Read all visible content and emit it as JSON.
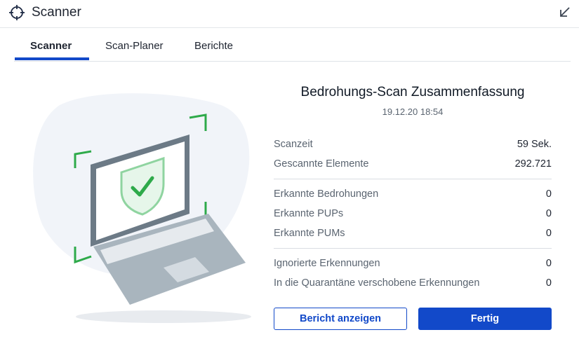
{
  "window": {
    "title": "Scanner"
  },
  "tabs": [
    {
      "label": "Scanner"
    },
    {
      "label": "Scan-Planer"
    },
    {
      "label": "Berichte"
    }
  ],
  "summary": {
    "title": "Bedrohungs-Scan Zusammenfassung",
    "date": "19.12.20 18:54",
    "rows": [
      {
        "label": "Scanzeit",
        "value": "59 Sek."
      },
      {
        "label": "Gescannte Elemente",
        "value": "292.721"
      },
      {
        "label": "Erkannte Bedrohungen",
        "value": "0"
      },
      {
        "label": "Erkannte PUPs",
        "value": "0"
      },
      {
        "label": "Erkannte PUMs",
        "value": "0"
      },
      {
        "label": "Ignorierte Erkennungen",
        "value": "0"
      },
      {
        "label": "In die Quarantäne verschobene Erkennungen",
        "value": "0"
      }
    ]
  },
  "buttons": {
    "report": "Bericht anzeigen",
    "done": "Fertig"
  },
  "colors": {
    "accent": "#1249c9",
    "success_green": "#2eaa4a",
    "laptop_gray": "#6c7a86"
  },
  "icons": {
    "app": "crosshair-icon",
    "collapse": "arrow-down-left-icon",
    "illustration": "laptop-shield-check-icon"
  }
}
